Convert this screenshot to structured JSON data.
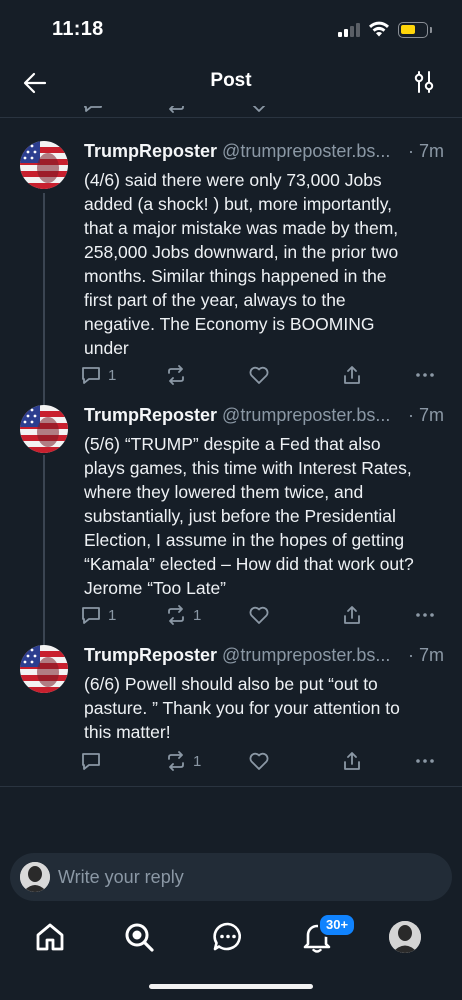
{
  "status_bar": {
    "time": "11:18",
    "battery_level": 0.6
  },
  "header": {
    "title": "Post",
    "back_icon": "arrow-left-icon",
    "options_icon": "sliders-icon"
  },
  "posts": [
    {
      "name": "TrumpReposter",
      "handle": "@trumpreposter.bs...",
      "time": "· 7m",
      "lines": [
        "(4/6) said there were only 73,000 Jobs",
        "added (a shock! ) but, more importantly,",
        "that a major mistake was made by them,",
        "258,000 Jobs downward, in the prior two",
        "months. Similar things happened in the",
        "first part of the year, always to the",
        "negative. The Economy is BOOMING",
        "under"
      ],
      "replies": "1",
      "reposts": "",
      "likes": ""
    },
    {
      "name": "TrumpReposter",
      "handle": "@trumpreposter.bs...",
      "time": "· 7m",
      "lines": [
        "(5/6) “TRUMP” despite a Fed that also",
        "plays games, this time with Interest Rates,",
        "where they lowered them twice, and",
        "substantially, just before the Presidential",
        "Election, I assume in the hopes of getting",
        "“Kamala” elected – How did that work out?",
        "Jerome “Too Late”"
      ],
      "replies": "1",
      "reposts": "1",
      "likes": ""
    },
    {
      "name": "TrumpReposter",
      "handle": "@trumpreposter.bs...",
      "time": "· 7m",
      "lines": [
        "(6/6) Powell should also be put “out to",
        "pasture. ” Thank you for your attention to",
        "this matter!"
      ],
      "replies": "",
      "reposts": "1",
      "likes": ""
    }
  ],
  "reply": {
    "placeholder": "Write your reply"
  },
  "nav": {
    "items": [
      "home-icon",
      "search-icon",
      "chat-icon",
      "notifications-icon",
      "profile-avatar"
    ],
    "notifications_badge": "30+"
  },
  "colors": {
    "background": "#161e27",
    "muted": "#8b98a5",
    "accent": "#1083fe",
    "battery": "#ffd60a"
  }
}
